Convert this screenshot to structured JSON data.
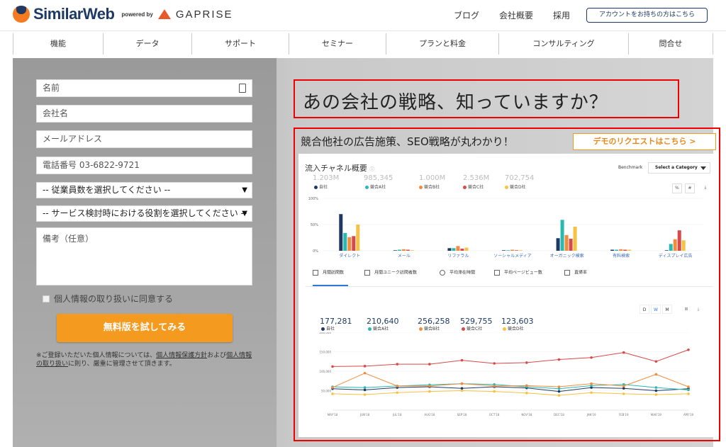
{
  "header": {
    "logo_text": "SimilarWeb",
    "powered_by": "powered by",
    "partner": "GAPRISE",
    "links": [
      "ブログ",
      "会社概要",
      "採用"
    ],
    "account_button": "アカウントをお持ちの方はこちら"
  },
  "nav": {
    "items": [
      "機能",
      "データ",
      "サポート",
      "セミナー",
      "プランと料金",
      "コンサルティング",
      "問合せ"
    ]
  },
  "form": {
    "name_placeholder": "名前",
    "company_placeholder": "会社名",
    "email_placeholder": "メールアドレス",
    "phone_placeholder": "電話番号 03-6822-9721",
    "employees_select": "-- 従業員数を選択してください --",
    "role_select": "-- サービス検討時における役割を選択してください --",
    "remarks_placeholder": "備考（任意）",
    "agree_label": "個人情報の取り扱いに同意する",
    "submit_label": "無料版を試してみる",
    "note_prefix": "※ご登録いただいた個人情報については、",
    "note_link1": "個人情報保護方針",
    "note_mid": "および",
    "note_link2": "個人情報の取り扱い",
    "note_suffix": "に則り、厳重に管理させて頂きます。"
  },
  "hero": {
    "headline": "あの会社の戦略、知っていますか？",
    "subheadline": "競合他社の広告施策、SEO戦略が丸わかり！",
    "demo_button": "デモのリクエストはこちら >"
  },
  "dashboard": {
    "title": "流入チャネル概要",
    "benchmark_label": "Benchmark",
    "benchmark_select": "Select a Category",
    "pct_button": "%",
    "num_button": "#",
    "metrics": [
      {
        "value": "1.203M",
        "label": "自社",
        "color": "#1e3a64"
      },
      {
        "value": "985,345",
        "label": "競合A社",
        "color": "#2ab8b0"
      },
      {
        "value": "1.000M",
        "label": "競合B社",
        "color": "#f28b3b"
      },
      {
        "value": "2.536M",
        "label": "競合C社",
        "color": "#d94949"
      },
      {
        "value": "702,754",
        "label": "競合D社",
        "color": "#f5c242"
      }
    ],
    "tabs": [
      "月間訪問数",
      "月間ユニーク訪問者数",
      "平均滞在時間",
      "平均ページビュー数",
      "直帰率"
    ],
    "period_buttons": [
      "D",
      "W",
      "M"
    ],
    "bottom_metrics": [
      {
        "value": "177,281",
        "label": "自社",
        "color": "#1e3a64"
      },
      {
        "value": "210,640",
        "label": "競合A社",
        "color": "#2ab8b0"
      },
      {
        "value": "256,258",
        "label": "競合B社",
        "color": "#f28b3b"
      },
      {
        "value": "529,755",
        "label": "競合C社",
        "color": "#d94949"
      },
      {
        "value": "123,603",
        "label": "競合D社",
        "color": "#f5c242"
      }
    ]
  },
  "chart_data": [
    {
      "type": "bar",
      "categories": [
        "ダイレクト",
        "メール",
        "リファラル",
        "ソーシャルメディア",
        "オーガニック検索",
        "有料検索",
        "ディスプレイ広告"
      ],
      "y_tick_labels": [
        "0%",
        "50%",
        "100%"
      ],
      "ylim": [
        0,
        100
      ],
      "series": [
        {
          "name": "自社",
          "values": [
            70,
            1,
            5,
            1,
            24,
            2,
            1
          ]
        },
        {
          "name": "競合A社",
          "values": [
            34,
            2,
            5,
            1,
            59,
            2,
            13
          ]
        },
        {
          "name": "競合B社",
          "values": [
            26,
            3,
            9,
            2,
            30,
            3,
            22
          ]
        },
        {
          "name": "競合C社",
          "values": [
            28,
            2,
            4,
            1,
            23,
            2,
            39
          ]
        },
        {
          "name": "競合D社",
          "values": [
            50,
            1,
            6,
            1,
            46,
            2,
            20
          ]
        }
      ]
    },
    {
      "type": "line",
      "x": [
        "MAY'18",
        "JUN'18",
        "JUL'18",
        "AUG'18",
        "SEP'18",
        "OCT'18",
        "NOV'18",
        "DEC'18",
        "JAN'19",
        "FEB'19",
        "MAR'19",
        "APR'19"
      ],
      "y_tick_labels": [
        "50,000",
        "100,000",
        "150,000",
        "200,000"
      ],
      "ylim": [
        0,
        200000
      ],
      "series": [
        {
          "name": "自社",
          "values": [
            55000,
            52000,
            58000,
            60000,
            56000,
            60000,
            57000,
            48000,
            58000,
            56000,
            50000,
            55000
          ]
        },
        {
          "name": "競合A社",
          "values": [
            60000,
            58000,
            62000,
            65000,
            68000,
            66000,
            60000,
            55000,
            63000,
            66000,
            58000,
            52000
          ]
        },
        {
          "name": "競合B社",
          "values": [
            58000,
            95000,
            62000,
            62000,
            68000,
            62000,
            63000,
            60000,
            68000,
            62000,
            92000,
            60000
          ]
        },
        {
          "name": "競合C社",
          "values": [
            112000,
            113000,
            118000,
            118000,
            128000,
            120000,
            122000,
            130000,
            135000,
            148000,
            125000,
            155000
          ]
        },
        {
          "name": "競合D社",
          "values": [
            42000,
            40000,
            45000,
            48000,
            50000,
            48000,
            44000,
            38000,
            45000,
            42000,
            40000,
            42000
          ]
        }
      ]
    }
  ]
}
